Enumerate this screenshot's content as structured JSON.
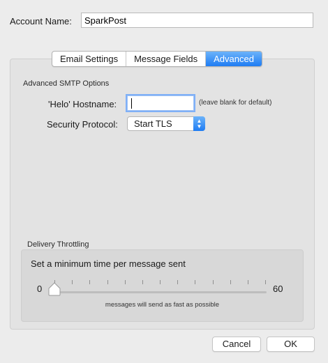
{
  "account": {
    "label": "Account Name:",
    "value": "SparkPost"
  },
  "tabs": [
    {
      "label": "Email Settings",
      "active": false
    },
    {
      "label": "Message Fields",
      "active": false
    },
    {
      "label": "Advanced",
      "active": true
    }
  ],
  "advanced_smtp": {
    "title": "Advanced SMTP Options",
    "helo_label": "'Helo' Hostname:",
    "helo_value": "",
    "helo_hint": "(leave blank for default)",
    "security_label": "Security Protocol:",
    "security_value": "Start TLS"
  },
  "throttling": {
    "title": "Delivery Throttling",
    "description": "Set a minimum time per message sent",
    "min_label": "0",
    "max_label": "60",
    "slider_value": 0,
    "caption": "messages will send as fast as possible"
  },
  "buttons": {
    "cancel": "Cancel",
    "ok": "OK"
  },
  "colors": {
    "accent": "#1e7cf3"
  },
  "icons": {
    "select_arrows": "up-down-chevron-icon",
    "slider_thumb": "slider-thumb-icon"
  }
}
